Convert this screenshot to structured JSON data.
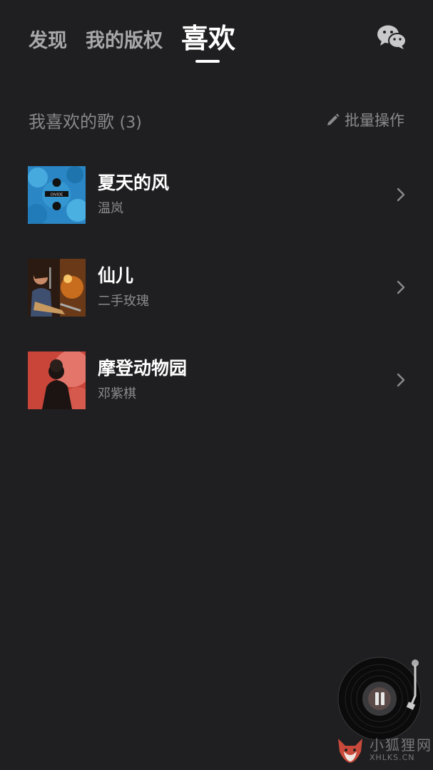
{
  "tabs": [
    {
      "label": "发现"
    },
    {
      "label": "我的版权"
    },
    {
      "label": "喜欢"
    }
  ],
  "section": {
    "title": "我喜欢的歌",
    "count": "(3)",
    "batch_label": "批量操作"
  },
  "songs": [
    {
      "title": "夏天的风",
      "artist": "温岚"
    },
    {
      "title": "仙儿",
      "artist": "二手玫瑰"
    },
    {
      "title": "摩登动物园",
      "artist": "邓紫棋"
    }
  ],
  "cover_texts": {
    "divide": "DIVIDE"
  },
  "watermark": {
    "main": "小狐狸网",
    "sub": "XHLKS.CN"
  },
  "colors": {
    "background": "#1f1f21",
    "muted_text": "#8a8a8c",
    "active_text": "#ffffff"
  },
  "icons": {
    "wechat": "wechat-icon",
    "batch": "pencil-icon",
    "chevron": "chevron-right-icon",
    "player": "vinyl-record-icon"
  }
}
